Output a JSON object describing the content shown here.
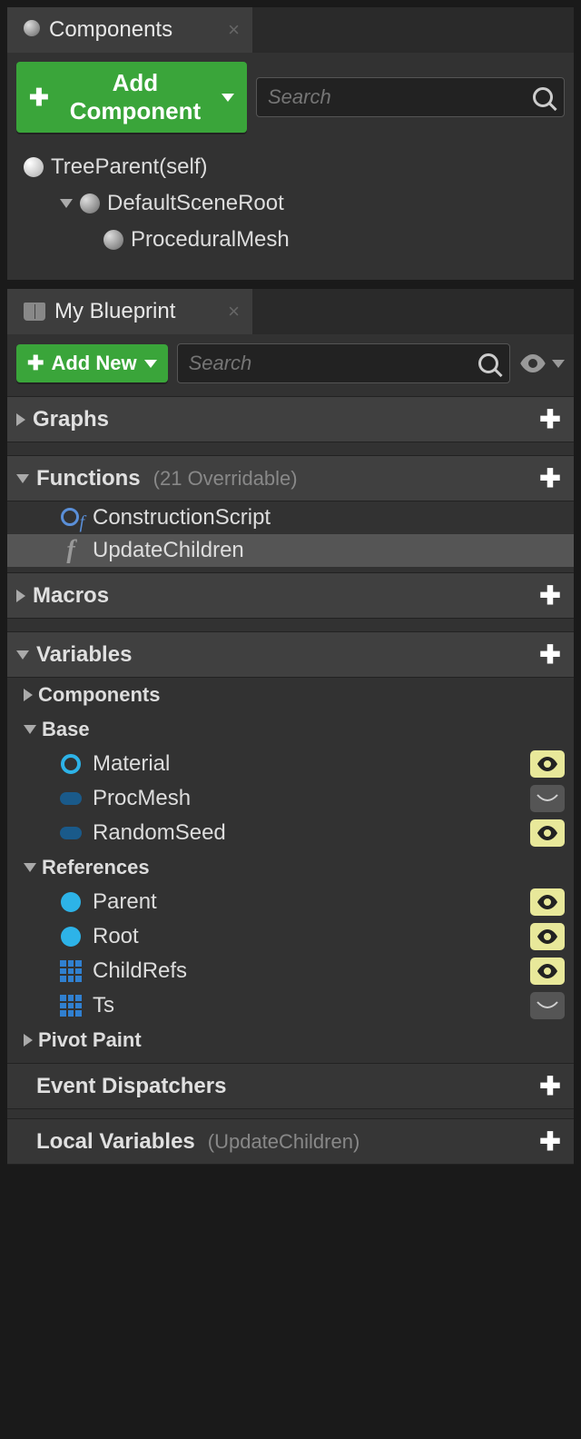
{
  "components_panel": {
    "title": "Components",
    "add_button": "Add Component",
    "search_placeholder": "Search",
    "tree": {
      "root": "TreeParent(self)",
      "scene_root": "DefaultSceneRoot",
      "child1": "ProceduralMesh"
    }
  },
  "blueprint_panel": {
    "title": "My Blueprint",
    "add_button": "Add New",
    "search_placeholder": "Search",
    "sections": {
      "graphs": {
        "label": "Graphs"
      },
      "functions": {
        "label": "Functions",
        "subtitle": "(21 Overridable)",
        "items": {
          "construction": "ConstructionScript",
          "update_children": "UpdateChildren"
        }
      },
      "macros": {
        "label": "Macros"
      },
      "variables": {
        "label": "Variables",
        "groups": {
          "components": "Components",
          "base": {
            "label": "Base",
            "items": {
              "material": "Material",
              "procmesh": "ProcMesh",
              "randomseed": "RandomSeed"
            }
          },
          "references": {
            "label": "References",
            "items": {
              "parent": "Parent",
              "root": "Root",
              "childrefs": "ChildRefs",
              "ts": "Ts"
            }
          },
          "pivot_paint": "Pivot Paint"
        }
      },
      "dispatchers": {
        "label": "Event Dispatchers"
      },
      "locals": {
        "label": "Local Variables",
        "subtitle": "(UpdateChildren)"
      }
    }
  }
}
